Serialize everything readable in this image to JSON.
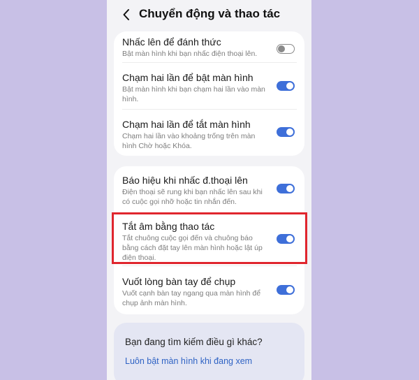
{
  "header": {
    "back_icon": "chevron-left-icon",
    "title": "Chuyển động và thao tác"
  },
  "group1": [
    {
      "title": "Nhấc lên để đánh thức",
      "desc": "Bật màn hình khi bạn nhấc điện thoại lên.",
      "enabled": false
    },
    {
      "title": "Chạm hai lần để bật màn hình",
      "desc": "Bật màn hình khi bạn chạm hai lần vào màn hình.",
      "enabled": true
    },
    {
      "title": "Chạm hai lần để tắt màn hình",
      "desc": "Chạm hai lần vào khoảng trống trên màn hình Chờ hoặc Khóa.",
      "enabled": true
    }
  ],
  "group2": [
    {
      "title": "Báo hiệu khi nhấc đ.thoại lên",
      "desc": "Điện thoại sẽ rung khi bạn nhấc lên sau khi có cuộc gọi nhỡ hoặc tin nhắn đến.",
      "enabled": true
    },
    {
      "title": "Tắt âm bằng thao tác",
      "desc": "Tắt chuông cuộc gọi đến và chuông báo bằng cách đặt tay lên màn hình hoặc lật úp điện thoại.",
      "enabled": true
    },
    {
      "title": "Vuốt lòng bàn tay để chụp",
      "desc": "Vuốt cạnh bàn tay ngang qua màn hình để chụp ảnh màn hình.",
      "enabled": true
    }
  ],
  "suggest": {
    "question": "Bạn đang tìm kiếm điều gì khác?",
    "link": "Luôn bật màn hình khi đang xem"
  },
  "colors": {
    "accent": "#3e6fd9",
    "highlight": "#e0262e",
    "background": "#c8c0e6"
  }
}
